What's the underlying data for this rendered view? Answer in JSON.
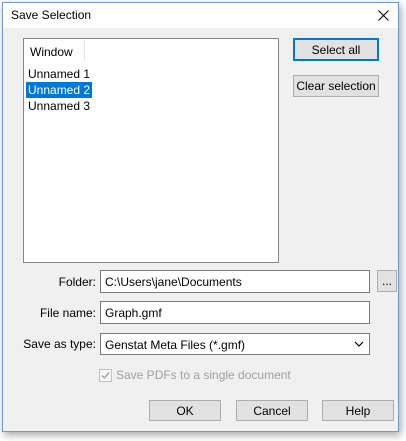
{
  "dialog": {
    "title": "Save Selection"
  },
  "list": {
    "header": "Window",
    "items": [
      "Unnamed 1",
      "Unnamed 2",
      "Unnamed 3"
    ],
    "selected_index": 1
  },
  "buttons": {
    "select_all": "Select all",
    "clear_selection": "Clear selection",
    "browse": "...",
    "ok": "OK",
    "cancel": "Cancel",
    "help": "Help"
  },
  "form": {
    "folder_label": "Folder:",
    "folder_value": "C:\\Users\\jane\\Documents",
    "filename_label": "File name:",
    "filename_value": "Graph.gmf",
    "savetype_label": "Save as type:",
    "savetype_value": "Genstat Meta Files (*.gmf)",
    "single_pdf_label": "Save PDFs to a single document",
    "single_pdf_checked": true,
    "single_pdf_enabled": false
  },
  "colors": {
    "selection": "#0078d7",
    "window_border": "#6f9bd1",
    "disabled_text": "#a0a0a0"
  }
}
